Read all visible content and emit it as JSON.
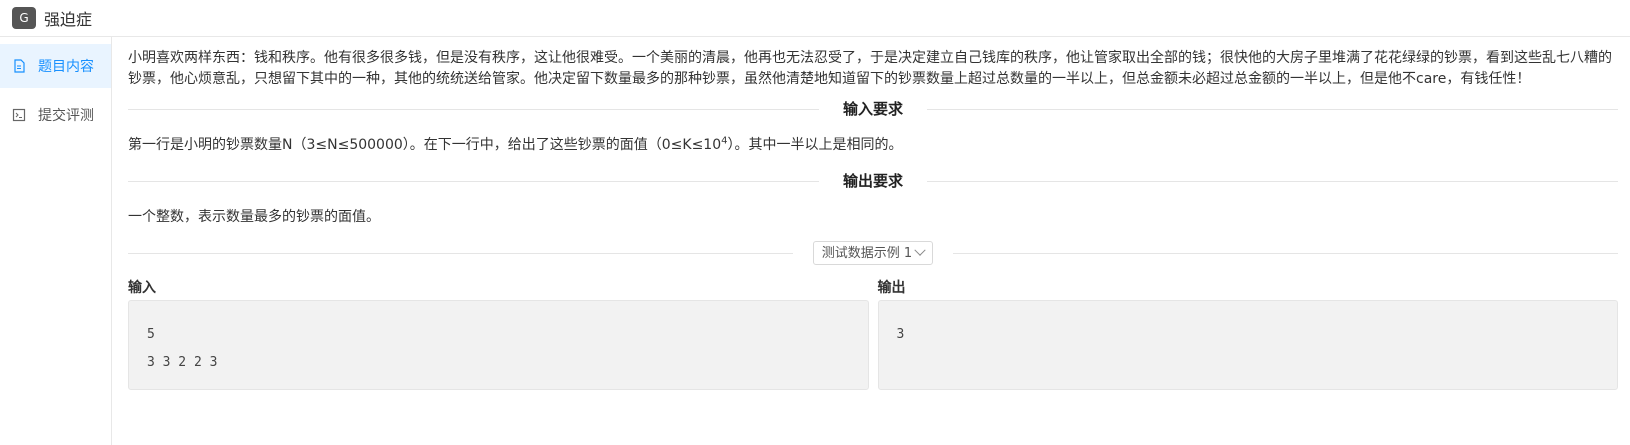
{
  "app": {
    "badge": "G",
    "title": "强迫症"
  },
  "sidebar": {
    "items": [
      {
        "label": "题目内容",
        "icon": "document-icon",
        "active": true
      },
      {
        "label": "提交评测",
        "icon": "terminal-icon",
        "active": false
      }
    ]
  },
  "problem": {
    "description": "小明喜欢两样东西：钱和秩序。他有很多很多钱，但是没有秩序，这让他很难受。一个美丽的清晨，他再也无法忍受了，于是决定建立自己钱库的秩序，他让管家取出全部的钱；很快他的大房子里堆满了花花绿绿的钞票，看到这些乱七八糟的钞票，他心烦意乱，只想留下其中的一种，其他的统统送给管家。他决定留下数量最多的那种钞票，虽然他清楚地知道留下的钞票数量上超过总数量的一半以上，但总金额未必超过总金额的一半以上，但是他不care，有钱任性！",
    "input_heading": "输入要求",
    "input_text_before": "第一行是小明的钞票数量N（3≤N≤500000）。在下一行中，给出了这些钞票的面值（0≤K≤10",
    "input_sup": "4",
    "input_text_after": "）。其中一半以上是相同的。",
    "output_heading": "输出要求",
    "output_text": "一个整数，表示数量最多的钞票的面值。"
  },
  "example": {
    "selector_label": "测试数据示例 1",
    "input_label": "输入",
    "output_label": "输出",
    "input_value": "5\n3 3 2 2 3",
    "output_value": "3"
  }
}
